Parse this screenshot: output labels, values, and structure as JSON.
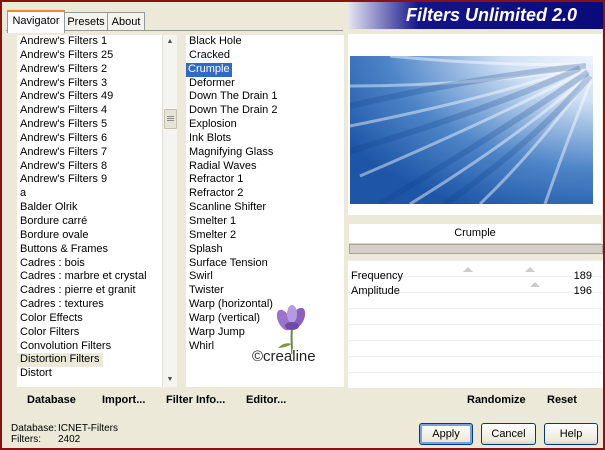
{
  "window": {
    "title": "Filters Unlimited 2.0"
  },
  "tabs": [
    {
      "label": "Navigator",
      "active": true
    },
    {
      "label": "Presets",
      "active": false
    },
    {
      "label": "About",
      "active": false
    }
  ],
  "categories": {
    "items": [
      "Andrew's Filters 1",
      "Andrew's Filters 25",
      "Andrew's Filters 2",
      "Andrew's Filters 3",
      "Andrew's Filters 49",
      "Andrew's Filters 4",
      "Andrew's Filters 5",
      "Andrew's Filters 6",
      "Andrew's Filters 7",
      "Andrew's Filters 8",
      "Andrew's Filters 9",
      "a",
      "Balder Olrik",
      "Bordure carré",
      "Bordure ovale",
      "Buttons & Frames",
      "Cadres : bois",
      "Cadres : marbre et crystal",
      "Cadres : pierre et granit",
      "Cadres : textures",
      "Color Effects",
      "Color Filters",
      "Convolution Filters",
      "Distortion Filters",
      "Distort"
    ],
    "selected": "Distortion Filters"
  },
  "filters": {
    "items": [
      "Black Hole",
      "Cracked",
      "Crumple",
      "Deformer",
      "Down The Drain 1",
      "Down The Drain 2",
      "Explosion",
      "Ink Blots",
      "Magnifying Glass",
      "Radial Waves",
      "Refractor 1",
      "Refractor 2",
      "Scanline Shifter",
      "Smelter 1",
      "Smelter 2",
      "Splash",
      "Surface Tension",
      "Swirl",
      "Twister",
      "Warp (horizontal)",
      "Warp (vertical)",
      "Warp Jump",
      "Whirl"
    ],
    "selected": "Crumple"
  },
  "preview": {
    "filter_name": "Crumple"
  },
  "parameters": [
    {
      "label": "Frequency",
      "value": "189"
    },
    {
      "label": "Amplitude",
      "value": "196"
    }
  ],
  "watermark": {
    "text": "©crealine"
  },
  "toolbar": {
    "database_label": "Database",
    "import_label": "Import...",
    "filter_info_label": "Filter Info...",
    "editor_label": "Editor...",
    "randomize_label": "Randomize",
    "reset_label": "Reset"
  },
  "status": {
    "database_key": "Database:",
    "database_value": "ICNET-Filters",
    "filters_key": "Filters:",
    "filters_value": "2402"
  },
  "buttons": {
    "apply_label": "Apply",
    "cancel_label": "Cancel",
    "help_label": "Help"
  },
  "colors": {
    "banner": "#0a0a7a",
    "selection": "#316ac5",
    "border": "#8b1010"
  }
}
